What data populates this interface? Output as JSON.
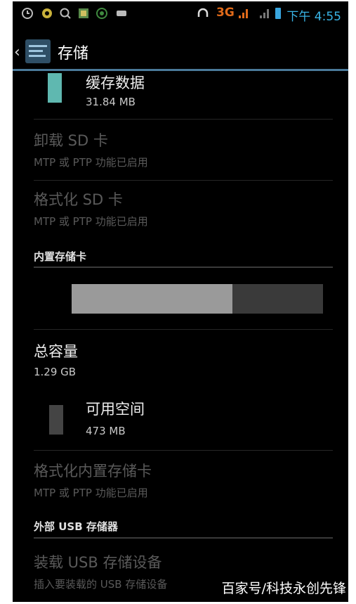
{
  "status_bar": {
    "network": "3G",
    "time": "下午 4:55"
  },
  "action_bar": {
    "title": "存储"
  },
  "list": {
    "cached": {
      "title": "缓存数据",
      "value": "31.84 MB",
      "color": "#5fb8b0"
    },
    "unmount_sd": {
      "title": "卸载 SD 卡",
      "subtitle": "MTP 或 PTP 功能已启用"
    },
    "format_sd": {
      "title": "格式化 SD 卡",
      "subtitle": "MTP 或 PTP 功能已启用"
    },
    "internal_section": "内置存储卡",
    "usage_bar": {
      "used_fraction": 0.64,
      "used_color": "#9a9a9a",
      "free_color": "#3a3a3a"
    },
    "total": {
      "title": "总容量",
      "value": "1.29 GB"
    },
    "available": {
      "title": "可用空间",
      "value": "473 MB",
      "color": "#444444"
    },
    "format_internal": {
      "title": "格式化内置存储卡",
      "subtitle": "MTP 或 PTP 功能已启用"
    },
    "usb_section": "外部 USB 存储器",
    "mount_usb": {
      "title": "装载 USB 存储设备",
      "subtitle": "插入要装载的 USB 存储设备"
    }
  },
  "watermark": "百家号/科技永创先锋"
}
